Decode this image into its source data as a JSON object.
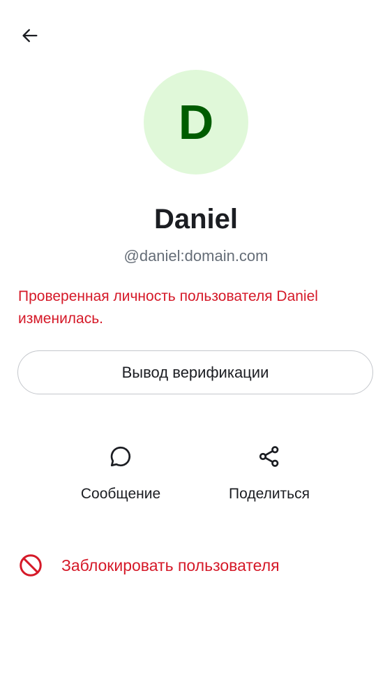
{
  "header": {
    "back_icon": "arrow-left-icon"
  },
  "profile": {
    "avatar_letter": "D",
    "avatar_bg_color": "#e0f8d9",
    "avatar_letter_color": "#005c00",
    "display_name": "Daniel",
    "user_id": "@daniel:domain.com"
  },
  "verification": {
    "warning": "Проверенная личность пользователя Daniel изменилась.",
    "warning_color": "#d51928",
    "button_label": "Вывод верификации"
  },
  "actions": [
    {
      "icon": "chat-bubble-icon",
      "label": "Сообщение"
    },
    {
      "icon": "share-icon",
      "label": "Поделиться"
    }
  ],
  "block": {
    "icon": "block-icon",
    "label": "Заблокировать пользователя",
    "color": "#d51928"
  }
}
